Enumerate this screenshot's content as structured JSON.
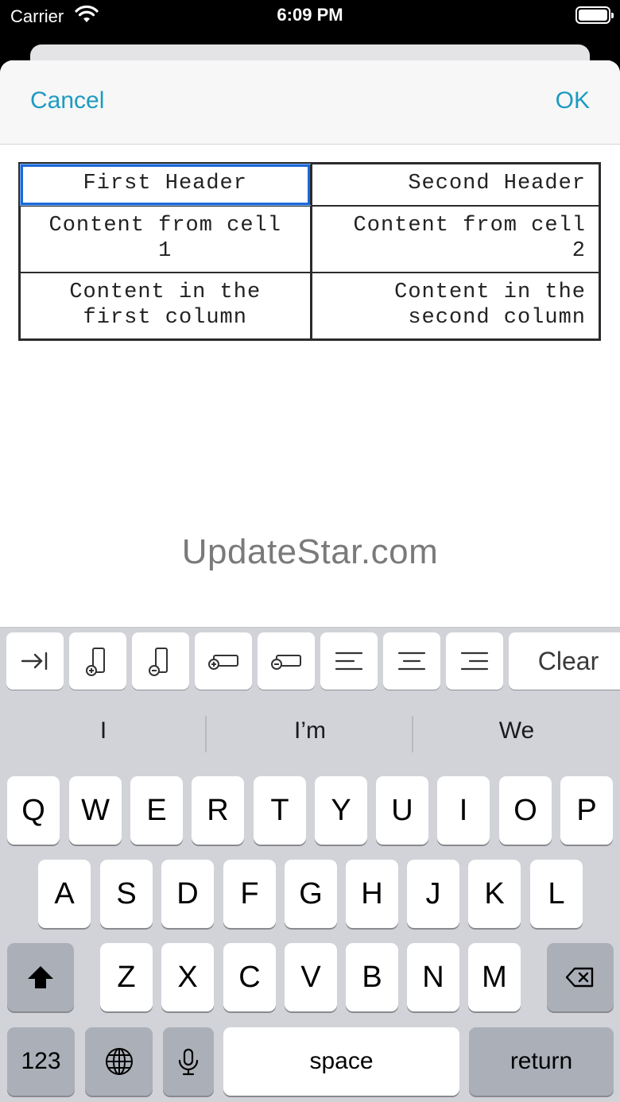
{
  "status": {
    "carrier": "Carrier",
    "time": "6:09 PM"
  },
  "nav": {
    "cancel": "Cancel",
    "ok": "OK"
  },
  "table": {
    "header": [
      "First Header",
      "Second Header"
    ],
    "rows": [
      [
        "Content from cell\n1",
        "Content from cell\n2"
      ],
      [
        "Content in the\nfirst column",
        "Content in the\nsecond column"
      ]
    ]
  },
  "watermark": "UpdateStar.com",
  "toolbar": {
    "icons": [
      "tab-indent-icon",
      "add-row-icon",
      "remove-row-icon",
      "add-column-icon",
      "remove-column-icon",
      "align-left-icon",
      "align-center-icon",
      "align-right-icon"
    ],
    "clear": "Clear"
  },
  "keyboard": {
    "suggestions": [
      "I",
      "I’m",
      "We"
    ],
    "row1": [
      "Q",
      "W",
      "E",
      "R",
      "T",
      "Y",
      "U",
      "I",
      "O",
      "P"
    ],
    "row2": [
      "A",
      "S",
      "D",
      "F",
      "G",
      "H",
      "J",
      "K",
      "L"
    ],
    "row3": [
      "Z",
      "X",
      "C",
      "V",
      "B",
      "N",
      "M"
    ],
    "numbers": "123",
    "space": "space",
    "return": "return"
  }
}
